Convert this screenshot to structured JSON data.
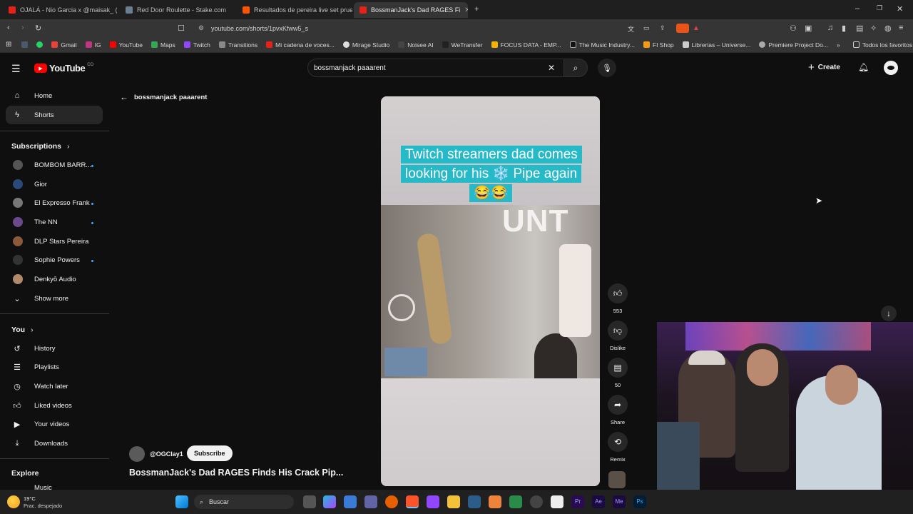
{
  "browser": {
    "tabs": [
      {
        "label": "OJALÁ - Nio Garcia x @maisak_ (Vid"
      },
      {
        "label": "Red Door Roulette - Stake.com"
      },
      {
        "label": "Resultados de pereira live set prueba"
      },
      {
        "label": "BossmanJack's Dad RAGES Fi"
      }
    ],
    "url": "youtube.com/shorts/1pvxKfww5_s",
    "bookmarks": [
      "Gmail",
      "IG",
      "YouTube",
      "Maps",
      "Twitch",
      "Transitions",
      "Mi cadena de voces...",
      "Mirage Studio",
      "Noisee AI",
      "WeTransfer",
      "FOCUS DATA - EMP...",
      "The Music Industry...",
      "FI Shop",
      "Librerias – Universe...",
      "Premiere Project Do..."
    ],
    "all_bookmarks": "Todos los favoritos"
  },
  "yt": {
    "logo": "YouTube",
    "logo_region": "CO",
    "search_value": "bossmanjack paaarent",
    "create_label": "Create",
    "back_query": "bossmanjack paaarent",
    "nav": [
      {
        "label": "Home"
      },
      {
        "label": "Shorts"
      }
    ],
    "subs_title": "Subscriptions",
    "subs": [
      {
        "label": "BOMBOM BARR..."
      },
      {
        "label": "Gior"
      },
      {
        "label": "El Expresso Frank"
      },
      {
        "label": "The NN"
      },
      {
        "label": "DLP Stars Pereira"
      },
      {
        "label": "Sophie Powers"
      },
      {
        "label": "Denkyō Audio"
      }
    ],
    "show_more": "Show more",
    "you_title": "You",
    "you_items": [
      {
        "label": "History"
      },
      {
        "label": "Playlists"
      },
      {
        "label": "Watch later"
      },
      {
        "label": "Liked videos"
      },
      {
        "label": "Your videos"
      },
      {
        "label": "Downloads"
      }
    ],
    "explore_title": "Explore",
    "explore_items": [
      {
        "label": "Music"
      }
    ],
    "short": {
      "caption": "Twitch streamers dad comes looking for his ❄️ Pipe again😂😂",
      "overlay_text": "UNT",
      "channel": "@OGClay1",
      "subscribe": "Subscribe",
      "title": "BossmanJack's Dad RAGES Finds His Crack Pip...",
      "likes": "553",
      "dislike": "Dislike",
      "comments": "50",
      "share": "Share",
      "remix": "Remix"
    }
  },
  "taskbar": {
    "weather_temp": "19°C",
    "weather_desc": "Prac. despejado",
    "search": "Buscar"
  }
}
